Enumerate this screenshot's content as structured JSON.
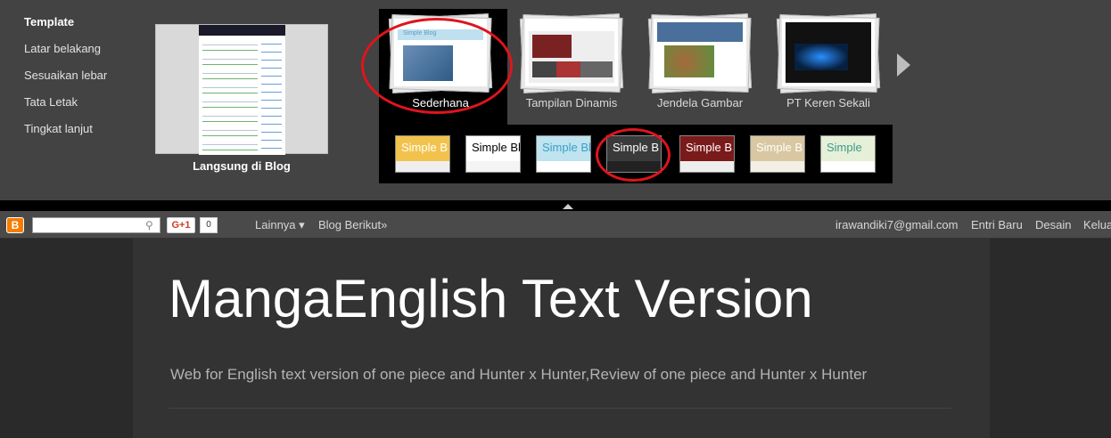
{
  "side_menu": [
    "Template",
    "Latar belakang",
    "Sesuaikan lebar",
    "Tata Letak",
    "Tingkat lanjut"
  ],
  "live_preview_label": "Langsung di Blog",
  "templates": [
    {
      "label": "Sederhana",
      "thumb_title": "Simple Blog"
    },
    {
      "label": "Tampilan Dinamis"
    },
    {
      "label": "Jendela Gambar"
    },
    {
      "label": "PT Keren Sekali"
    }
  ],
  "variants": [
    {
      "title": "Simple B",
      "bg": "#f2c34c",
      "fg": "#ffffff"
    },
    {
      "title": "Simple Blo",
      "bg": "#ffffff",
      "fg": "#000000"
    },
    {
      "title": "Simple Bl",
      "bg": "#bfe3ef",
      "fg": "#3aa0c8"
    },
    {
      "title": "Simple B",
      "bg": "#3a3a3a",
      "fg": "#ffffff"
    },
    {
      "title": "Simple B",
      "bg": "#7a1a1a",
      "fg": "#ffffff"
    },
    {
      "title": "Simple B",
      "bg": "#d8c7a0",
      "fg": "#ffffff"
    },
    {
      "title": "Simple",
      "bg": "#e6f0d8",
      "fg": "#3a9a8a"
    }
  ],
  "navbar": {
    "search_value": "",
    "gplus_label": "G+1",
    "gplus_count": "0",
    "more": "Lainnya ▾",
    "next_blog": "Blog Berikut»",
    "email": "irawandiki7@gmail.com",
    "new_post": "Entri Baru",
    "design": "Desain",
    "sign_out": "Kelua"
  },
  "blog": {
    "title": "MangaEnglish Text Version",
    "description": "Web for English text version of one piece and Hunter x Hunter,Review of one piece and Hunter x Hunter"
  },
  "colors": {
    "accent_ring": "#e0141c",
    "blogger_orange": "#f57d00"
  },
  "icons": [
    "blogger-logo-icon",
    "search-icon",
    "arrow-right-icon",
    "caret-up-icon"
  ]
}
